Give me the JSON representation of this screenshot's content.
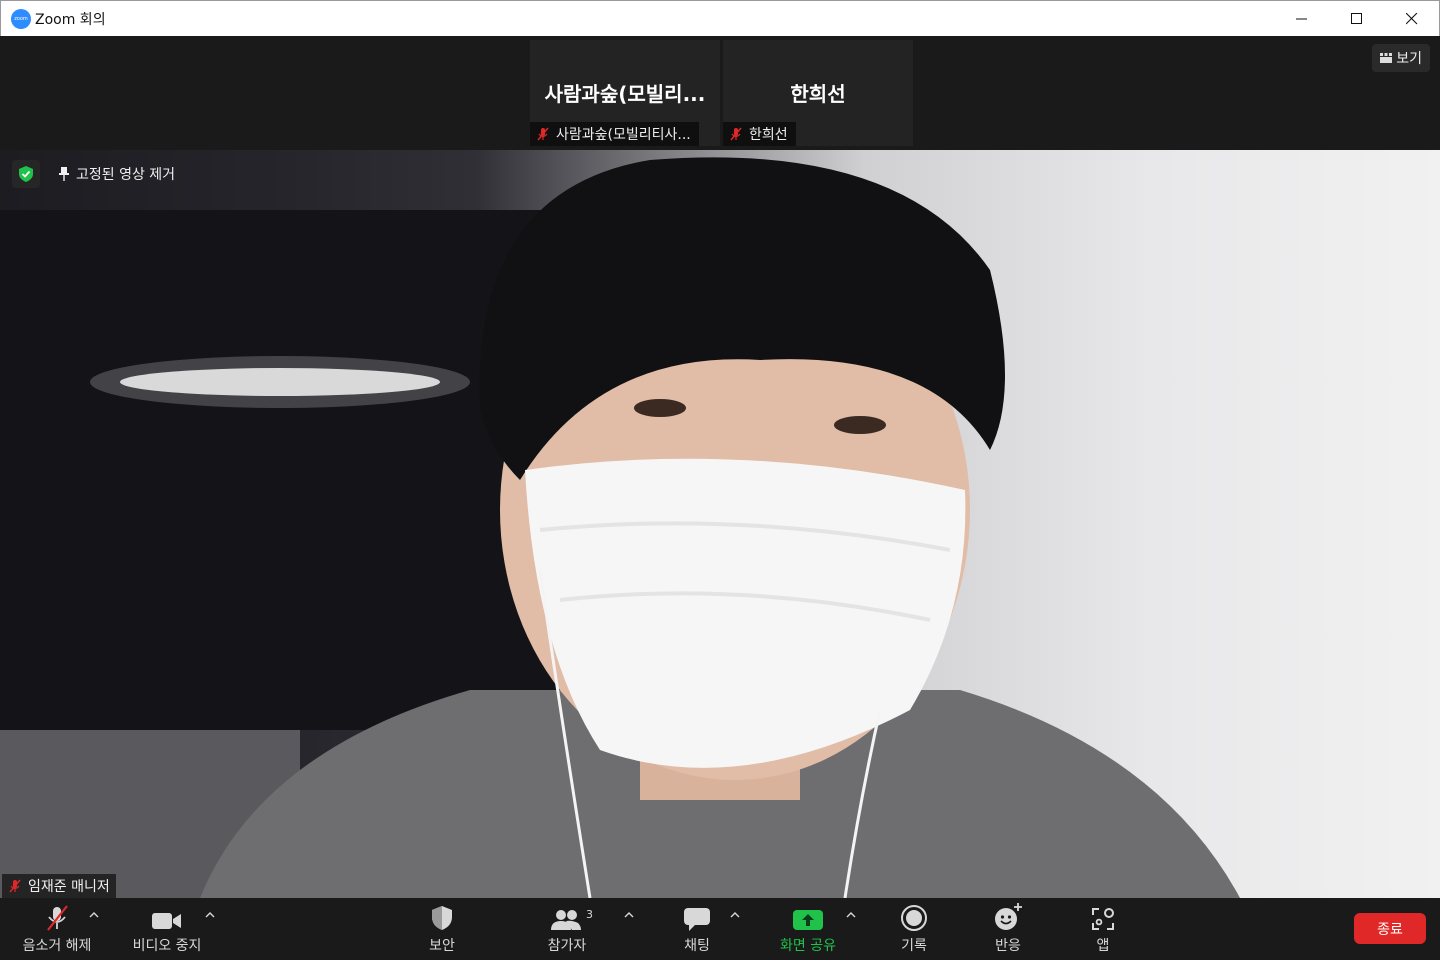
{
  "window": {
    "app_logo_text": "zoom",
    "title": "Zoom 회의",
    "controls": [
      "minimize-icon",
      "maximize-icon",
      "close-icon"
    ]
  },
  "top_strip": {
    "tiles": [
      {
        "display_name": "사람과숲(모빌리...",
        "label": "사람과숲(모빌리티사...",
        "mic": "muted"
      },
      {
        "display_name": "한희선",
        "label": "한희선",
        "mic": "muted"
      }
    ],
    "view_button": {
      "label": "보기",
      "icon": "grid-icon"
    }
  },
  "main_video": {
    "security_icon": "shield-check-icon",
    "unpin_label": "고정된 영상 제거",
    "participant_label": "임재준 매니저",
    "mic": "muted"
  },
  "toolbar": {
    "items": [
      {
        "label": "음소거 해제",
        "icon": "mic-muted-icon"
      },
      {
        "label": "비디오 중지",
        "icon": "video-camera-icon"
      },
      {
        "label": "보안",
        "icon": "shield-icon"
      },
      {
        "label": "참가자",
        "icon": "participants-icon",
        "count": "3"
      },
      {
        "label": "채팅",
        "icon": "chat-icon"
      },
      {
        "label": "화면 공유",
        "icon": "share-screen-icon"
      },
      {
        "label": "기록",
        "icon": "record-icon"
      },
      {
        "label": "반응",
        "icon": "reaction-icon"
      },
      {
        "label": "앱",
        "icon": "apps-icon"
      }
    ],
    "end_label": "종료"
  },
  "colors": {
    "share_green": "#21c24c",
    "end_red": "#e02828",
    "muted_red": "#e02828",
    "security_green": "#21c24c",
    "zoom_blue": "#2d8cff"
  }
}
